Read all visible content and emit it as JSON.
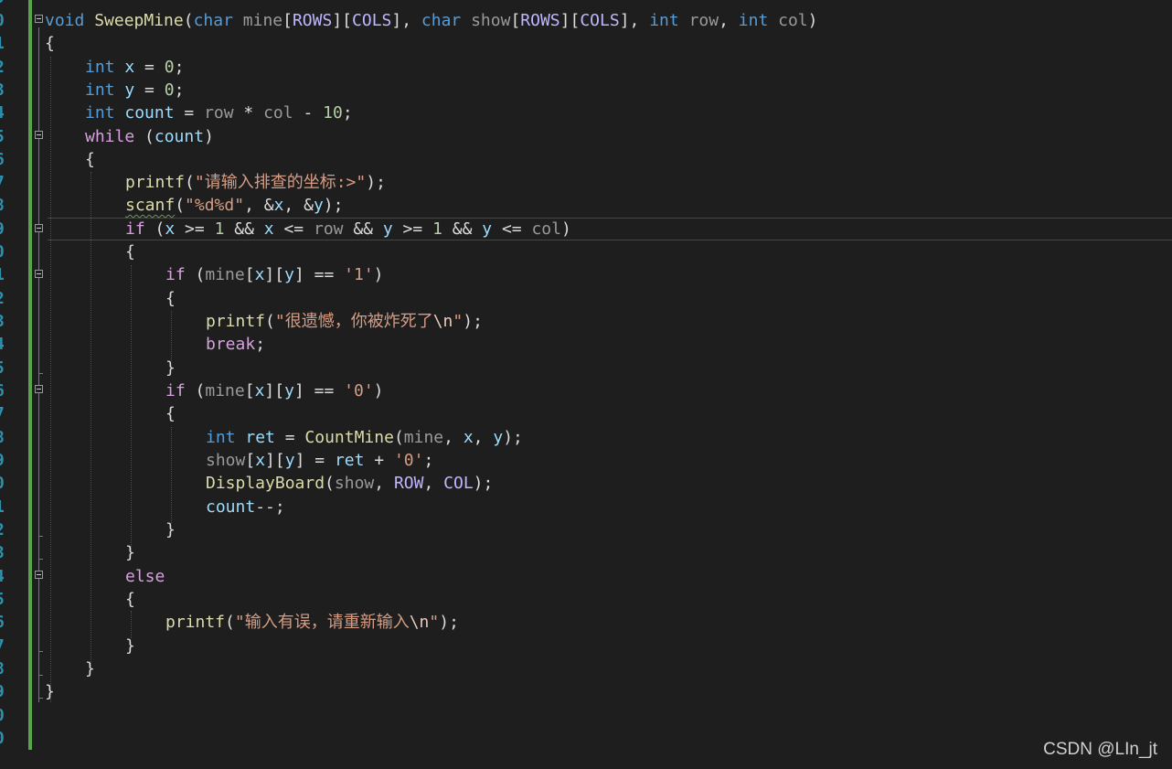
{
  "editor": {
    "line_numbers": [
      "9",
      "0",
      "1",
      "2",
      "3",
      "4",
      "5",
      "6",
      "7",
      "8",
      "9",
      "0",
      "1",
      "2",
      "3",
      "4",
      "5",
      "6",
      "7",
      "8",
      "9",
      "0",
      "1",
      "2",
      "3",
      "4",
      "5",
      "6",
      "7",
      "8",
      "9",
      "0"
    ],
    "code": {
      "l0a": "void ",
      "l0b": "SweepMine",
      "l0c": "(",
      "l0d": "char ",
      "l0e": "mine",
      "l0f": "[",
      "l0g": "ROWS",
      "l0h": "][",
      "l0i": "COLS",
      "l0j": "], ",
      "l0k": "char ",
      "l0l": "show",
      "l0m": "[",
      "l0n": "ROWS",
      "l0o": "][",
      "l0p": "COLS",
      "l0q": "], ",
      "l0r": "int ",
      "l0s": "row",
      "l0t": ", ",
      "l0u": "int ",
      "l0v": "col",
      "l0w": ")",
      "l1": "{",
      "l2a": "int ",
      "l2b": "x",
      "l2c": " = ",
      "l2d": "0",
      "l2e": ";",
      "l3a": "int ",
      "l3b": "y",
      "l3c": " = ",
      "l3d": "0",
      "l3e": ";",
      "l4a": "int ",
      "l4b": "count",
      "l4c": " = ",
      "l4d": "row",
      "l4e": " * ",
      "l4f": "col",
      "l4g": " - ",
      "l4h": "10",
      "l4i": ";",
      "l5a": "while",
      "l5b": " (",
      "l5c": "count",
      "l5d": ")",
      "l6": "{",
      "l7a": "printf",
      "l7b": "(",
      "l7c": "\"请输入排查的坐标:>\"",
      "l7d": ");",
      "l8a": "scanf",
      "l8b": "(",
      "l8c": "\"%d%d\"",
      "l8d": ", &",
      "l8e": "x",
      "l8f": ", &",
      "l8g": "y",
      "l8h": ");",
      "l9a": "if",
      "l9b": " (",
      "l9c": "x",
      "l9d": " >= ",
      "l9e": "1",
      "l9f": " && ",
      "l9g": "x",
      "l9h": " <= ",
      "l9i": "row",
      "l9j": " && ",
      "l9k": "y",
      "l9l": " >= ",
      "l9m": "1",
      "l9n": " && ",
      "l9o": "y",
      "l9p": " <= ",
      "l9q": "col",
      "l9r": ")",
      "l10": "{",
      "l11a": "if",
      "l11b": " (",
      "l11c": "mine",
      "l11d": "[",
      "l11e": "x",
      "l11f": "][",
      "l11g": "y",
      "l11h": "] == ",
      "l11i": "'1'",
      "l11j": ")",
      "l12": "{",
      "l13a": "printf",
      "l13b": "(",
      "l13c": "\"很遗憾，你被炸死了",
      "l13d": "\\n",
      "l13e": "\"",
      "l13f": ");",
      "l14a": "break",
      "l14b": ";",
      "l15": "}",
      "l16a": "if",
      "l16b": " (",
      "l16c": "mine",
      "l16d": "[",
      "l16e": "x",
      "l16f": "][",
      "l16g": "y",
      "l16h": "] == ",
      "l16i": "'0'",
      "l16j": ")",
      "l17": "{",
      "l18a": "int ",
      "l18b": "ret",
      "l18c": " = ",
      "l18d": "CountMine",
      "l18e": "(",
      "l18f": "mine",
      "l18g": ", ",
      "l18h": "x",
      "l18i": ", ",
      "l18j": "y",
      "l18k": ");",
      "l19a": "show",
      "l19b": "[",
      "l19c": "x",
      "l19d": "][",
      "l19e": "y",
      "l19f": "] = ",
      "l19g": "ret",
      "l19h": " + ",
      "l19i": "'0'",
      "l19j": ";",
      "l20a": "DisplayBoard",
      "l20b": "(",
      "l20c": "show",
      "l20d": ", ",
      "l20e": "ROW",
      "l20f": ", ",
      "l20g": "COL",
      "l20h": ");",
      "l21a": "count",
      "l21b": "--;",
      "l22": "}",
      "l23": "}",
      "l24": "else",
      "l25": "{",
      "l26a": "printf",
      "l26b": "(",
      "l26c": "\"输入有误，请重新输入",
      "l26d": "\\n",
      "l26e": "\"",
      "l26f": ");",
      "l27": "}",
      "l28": "}",
      "l29": "}"
    }
  },
  "watermark": "CSDN @LIn_jt"
}
